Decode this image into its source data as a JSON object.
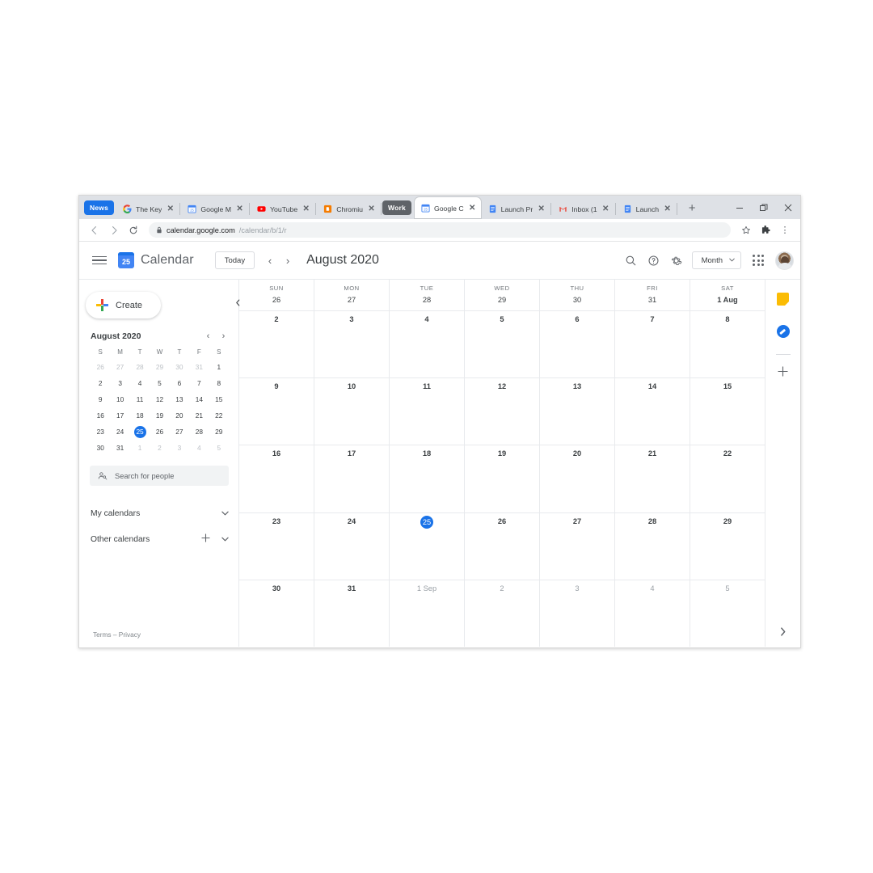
{
  "browser": {
    "tabs": [
      {
        "title": "The Key",
        "favicon": "google-g-icon",
        "group": null
      },
      {
        "title": "Google M",
        "favicon": "google-calendar-icon",
        "group": null
      },
      {
        "title": "YouTube",
        "favicon": "youtube-icon",
        "group": null
      },
      {
        "title": "Chromiu",
        "favicon": "chromium-blog-icon",
        "group": null
      },
      {
        "title": "Google C",
        "favicon": "google-calendar-icon",
        "group": "Work",
        "active": true
      },
      {
        "title": "Launch Pr",
        "favicon": "google-docs-icon",
        "group": null
      },
      {
        "title": "Inbox (1",
        "favicon": "gmail-icon",
        "group": null
      },
      {
        "title": "Launch",
        "favicon": "google-docs-icon",
        "group": null
      }
    ],
    "tab_groups": [
      {
        "label": "News",
        "color": "#1a73e8"
      },
      {
        "label": "Work",
        "color": "#5f6368"
      }
    ],
    "tab_close_label": "✕",
    "new_tab_label": "+",
    "window_controls": {
      "minimize": "—",
      "maximize": "❐",
      "close": "✕"
    },
    "nav": {
      "back": "←",
      "forward": "→",
      "reload": "⟳"
    },
    "url": {
      "lock": "🔒",
      "host": "calendar.google.com",
      "path": "/calendar/b/1/r"
    },
    "omnibox_actions": {
      "bookmark": "☆",
      "extensions": "🧩",
      "menu": "⋮"
    }
  },
  "gcal": {
    "header": {
      "menu_icon": "hamburger-menu-icon",
      "logo_day": "25",
      "logo_text": "Calendar",
      "today_label": "Today",
      "prev_label": "‹",
      "next_label": "›",
      "period_title": "August 2020",
      "search_icon": "search-icon",
      "help_icon": "help-icon",
      "settings_icon": "gear-icon",
      "view_label": "Month",
      "view_caret": "▼",
      "apps_icon": "apps-grid-icon",
      "avatar": "user-avatar"
    },
    "sidebar": {
      "create_label": "Create",
      "mini_calendar": {
        "month_label": "August 2020",
        "prev": "‹",
        "next": "›",
        "dow": [
          "S",
          "M",
          "T",
          "W",
          "T",
          "F",
          "S"
        ],
        "weeks": [
          [
            {
              "n": "26",
              "state": "muted"
            },
            {
              "n": "27",
              "state": "muted"
            },
            {
              "n": "28",
              "state": "muted"
            },
            {
              "n": "29",
              "state": "muted"
            },
            {
              "n": "30",
              "state": "muted"
            },
            {
              "n": "31",
              "state": "muted"
            },
            {
              "n": "1",
              "state": "normal"
            }
          ],
          [
            {
              "n": "2",
              "state": "normal"
            },
            {
              "n": "3",
              "state": "normal"
            },
            {
              "n": "4",
              "state": "normal"
            },
            {
              "n": "5",
              "state": "normal"
            },
            {
              "n": "6",
              "state": "normal"
            },
            {
              "n": "7",
              "state": "normal"
            },
            {
              "n": "8",
              "state": "normal"
            }
          ],
          [
            {
              "n": "9",
              "state": "normal"
            },
            {
              "n": "10",
              "state": "normal"
            },
            {
              "n": "11",
              "state": "normal"
            },
            {
              "n": "12",
              "state": "normal"
            },
            {
              "n": "13",
              "state": "normal"
            },
            {
              "n": "14",
              "state": "normal"
            },
            {
              "n": "15",
              "state": "normal"
            }
          ],
          [
            {
              "n": "16",
              "state": "normal"
            },
            {
              "n": "17",
              "state": "normal"
            },
            {
              "n": "18",
              "state": "normal"
            },
            {
              "n": "19",
              "state": "normal"
            },
            {
              "n": "20",
              "state": "normal"
            },
            {
              "n": "21",
              "state": "normal"
            },
            {
              "n": "22",
              "state": "normal"
            }
          ],
          [
            {
              "n": "23",
              "state": "normal"
            },
            {
              "n": "24",
              "state": "normal"
            },
            {
              "n": "25",
              "state": "today"
            },
            {
              "n": "26",
              "state": "normal"
            },
            {
              "n": "27",
              "state": "normal"
            },
            {
              "n": "28",
              "state": "normal"
            },
            {
              "n": "29",
              "state": "normal"
            }
          ],
          [
            {
              "n": "30",
              "state": "normal"
            },
            {
              "n": "31",
              "state": "normal"
            },
            {
              "n": "1",
              "state": "muted"
            },
            {
              "n": "2",
              "state": "muted"
            },
            {
              "n": "3",
              "state": "muted"
            },
            {
              "n": "4",
              "state": "muted"
            },
            {
              "n": "5",
              "state": "muted"
            }
          ]
        ]
      },
      "search_people_placeholder": "Search for people",
      "search_people_icon": "people-search-icon",
      "my_calendars_label": "My calendars",
      "other_calendars_label": "Other calendars",
      "chevron": "⌄",
      "plus": "+",
      "terms_privacy": "Terms – Privacy"
    },
    "grid": {
      "dow_headers": [
        "SUN",
        "MON",
        "TUE",
        "WED",
        "THU",
        "FRI",
        "SAT"
      ],
      "header_days": [
        {
          "n": "26",
          "state": "normal"
        },
        {
          "n": "27",
          "state": "normal"
        },
        {
          "n": "28",
          "state": "normal"
        },
        {
          "n": "29",
          "state": "normal"
        },
        {
          "n": "30",
          "state": "normal"
        },
        {
          "n": "31",
          "state": "normal"
        },
        {
          "n": "1 Aug",
          "state": "bold"
        }
      ],
      "weeks": [
        [
          {
            "n": "2",
            "state": "normal"
          },
          {
            "n": "3",
            "state": "normal"
          },
          {
            "n": "4",
            "state": "normal"
          },
          {
            "n": "5",
            "state": "normal"
          },
          {
            "n": "6",
            "state": "normal"
          },
          {
            "n": "7",
            "state": "normal"
          },
          {
            "n": "8",
            "state": "normal"
          }
        ],
        [
          {
            "n": "9",
            "state": "normal"
          },
          {
            "n": "10",
            "state": "normal"
          },
          {
            "n": "11",
            "state": "normal"
          },
          {
            "n": "12",
            "state": "normal"
          },
          {
            "n": "13",
            "state": "normal"
          },
          {
            "n": "14",
            "state": "normal"
          },
          {
            "n": "15",
            "state": "normal"
          }
        ],
        [
          {
            "n": "16",
            "state": "normal"
          },
          {
            "n": "17",
            "state": "normal"
          },
          {
            "n": "18",
            "state": "normal"
          },
          {
            "n": "19",
            "state": "normal"
          },
          {
            "n": "20",
            "state": "normal"
          },
          {
            "n": "21",
            "state": "normal"
          },
          {
            "n": "22",
            "state": "normal"
          }
        ],
        [
          {
            "n": "23",
            "state": "normal"
          },
          {
            "n": "24",
            "state": "normal"
          },
          {
            "n": "25",
            "state": "today"
          },
          {
            "n": "26",
            "state": "normal"
          },
          {
            "n": "27",
            "state": "normal"
          },
          {
            "n": "28",
            "state": "normal"
          },
          {
            "n": "29",
            "state": "normal"
          }
        ],
        [
          {
            "n": "30",
            "state": "normal"
          },
          {
            "n": "31",
            "state": "normal"
          },
          {
            "n": "1 Sep",
            "state": "muted"
          },
          {
            "n": "2",
            "state": "muted"
          },
          {
            "n": "3",
            "state": "muted"
          },
          {
            "n": "4",
            "state": "muted"
          },
          {
            "n": "5",
            "state": "muted"
          }
        ]
      ]
    },
    "rail": {
      "keep_icon": "google-keep-icon",
      "tasks_icon": "google-tasks-icon",
      "add_icon": "+",
      "expand_icon": "›"
    },
    "colors": {
      "accent": "#1a73e8",
      "keep_yellow": "#fbbc04",
      "border": "#e8eaed",
      "text": "#3c4043"
    }
  }
}
